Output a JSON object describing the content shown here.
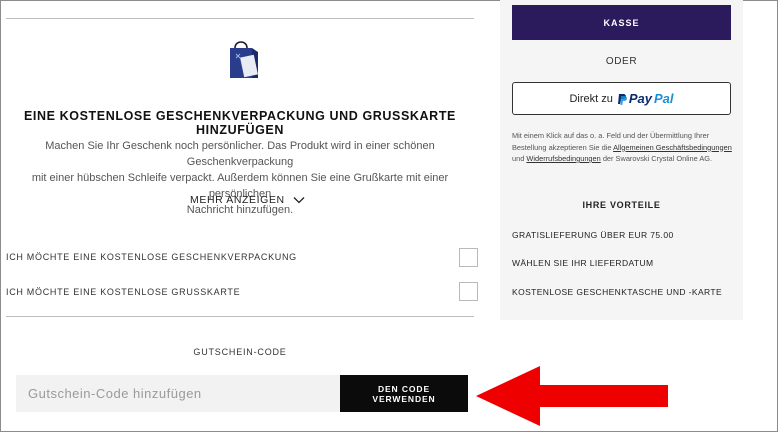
{
  "gift": {
    "title": "EINE KOSTENLOSE GESCHENKVERPACKUNG UND GRUSSKARTE HINZUFÜGEN",
    "desc_line1": "Machen Sie Ihr Geschenk noch persönlicher. Das Produkt wird in einer schönen Geschenkverpackung",
    "desc_line2": "mit einer hübschen Schleife verpackt. Außerdem können Sie eine Grußkarte mit einer persönlichen",
    "desc_line3": "Nachricht hinzufügen.",
    "more_label": "MEHR ANZEIGEN",
    "option_wrap": "ICH MÖCHTE EINE KOSTENLOSE GESCHENKVERPACKUNG",
    "option_card": "ICH MÖCHTE EINE KOSTENLOSE GRUSSKARTE"
  },
  "coupon": {
    "title": "GUTSCHEIN-CODE",
    "placeholder": "Gutschein-Code hinzufügen",
    "value": "",
    "button": "DEN CODE VERWENDEN"
  },
  "checkout": {
    "kasse": "KASSE",
    "oder": "ODER",
    "paypal_prefix": "Direkt zu",
    "paypal_pay": "Pay",
    "paypal_pal": "Pal",
    "legal_1": "Mit einem Klick auf das o. a. Feld und der Übermittlung Ihrer Bestellung akzeptieren Sie die ",
    "legal_link1": "Allgemeinen Geschäftsbedingungen",
    "legal_2": " und ",
    "legal_link2": "Widerrufsbedingungen",
    "legal_3": " der Swarovski Crystal Online AG."
  },
  "benefits": {
    "title": "IHRE VORTEILE",
    "items": [
      "GRATISLIEFERUNG ÜBER EUR 75.00",
      "WÄHLEN SIE IHR LIEFERDATUM",
      "KOSTENLOSE GESCHENKTASCHE UND -KARTE"
    ]
  },
  "colors": {
    "accent": "#2b1a5c",
    "arrow": "#ee0000",
    "panel": "#f5f5f5"
  }
}
